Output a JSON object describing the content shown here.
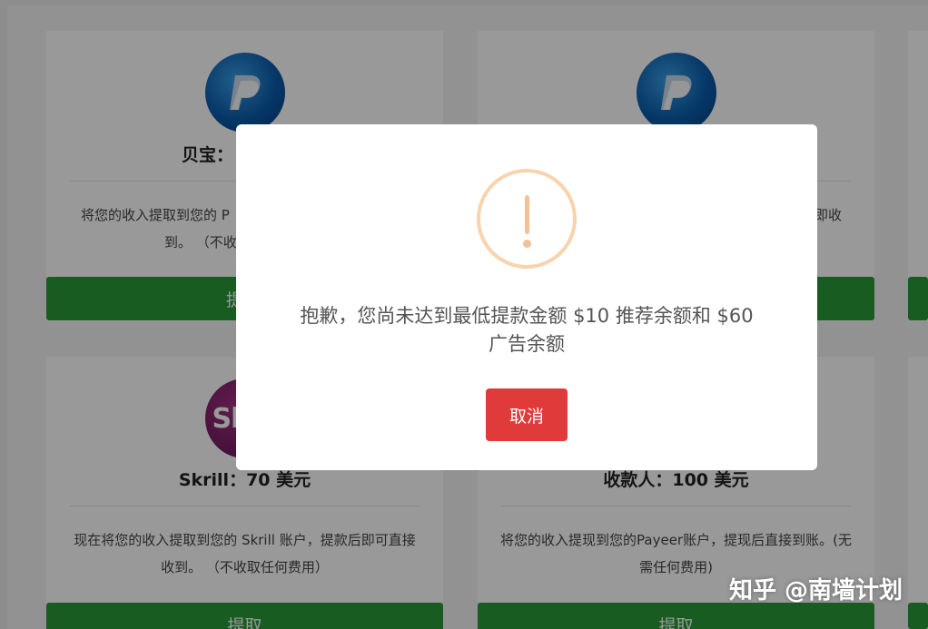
{
  "cards": [
    {
      "title": "贝宝：",
      "description": "将您的收入提取到您的 P",
      "description_line2": "到。 （不收",
      "button_label": "提"
    },
    {
      "description_right": "即收"
    },
    {
      "title": "Skrill：70 美元",
      "description": "现在将您的收入提取到您的 Skrill 账户，提款后即可直接收到。 （不收取任何费用）",
      "button_label": "提取",
      "logo_text": "Sk"
    },
    {
      "title": "收款人：100 美元",
      "description": "将您的收入提现到您的Payeer账户，提现后直接到账。(无需任何费用)",
      "button_label": "提取"
    }
  ],
  "modal": {
    "message": "抱歉，您尚未达到最低提款金额 $10 推荐余额和 $60 广告余额",
    "cancel_label": "取消"
  },
  "watermark": "知乎 @南墙计划",
  "colors": {
    "primary_green": "#2b9a3a",
    "cancel_red": "#e03a3a",
    "warning_orange": "#f8d3ae"
  }
}
